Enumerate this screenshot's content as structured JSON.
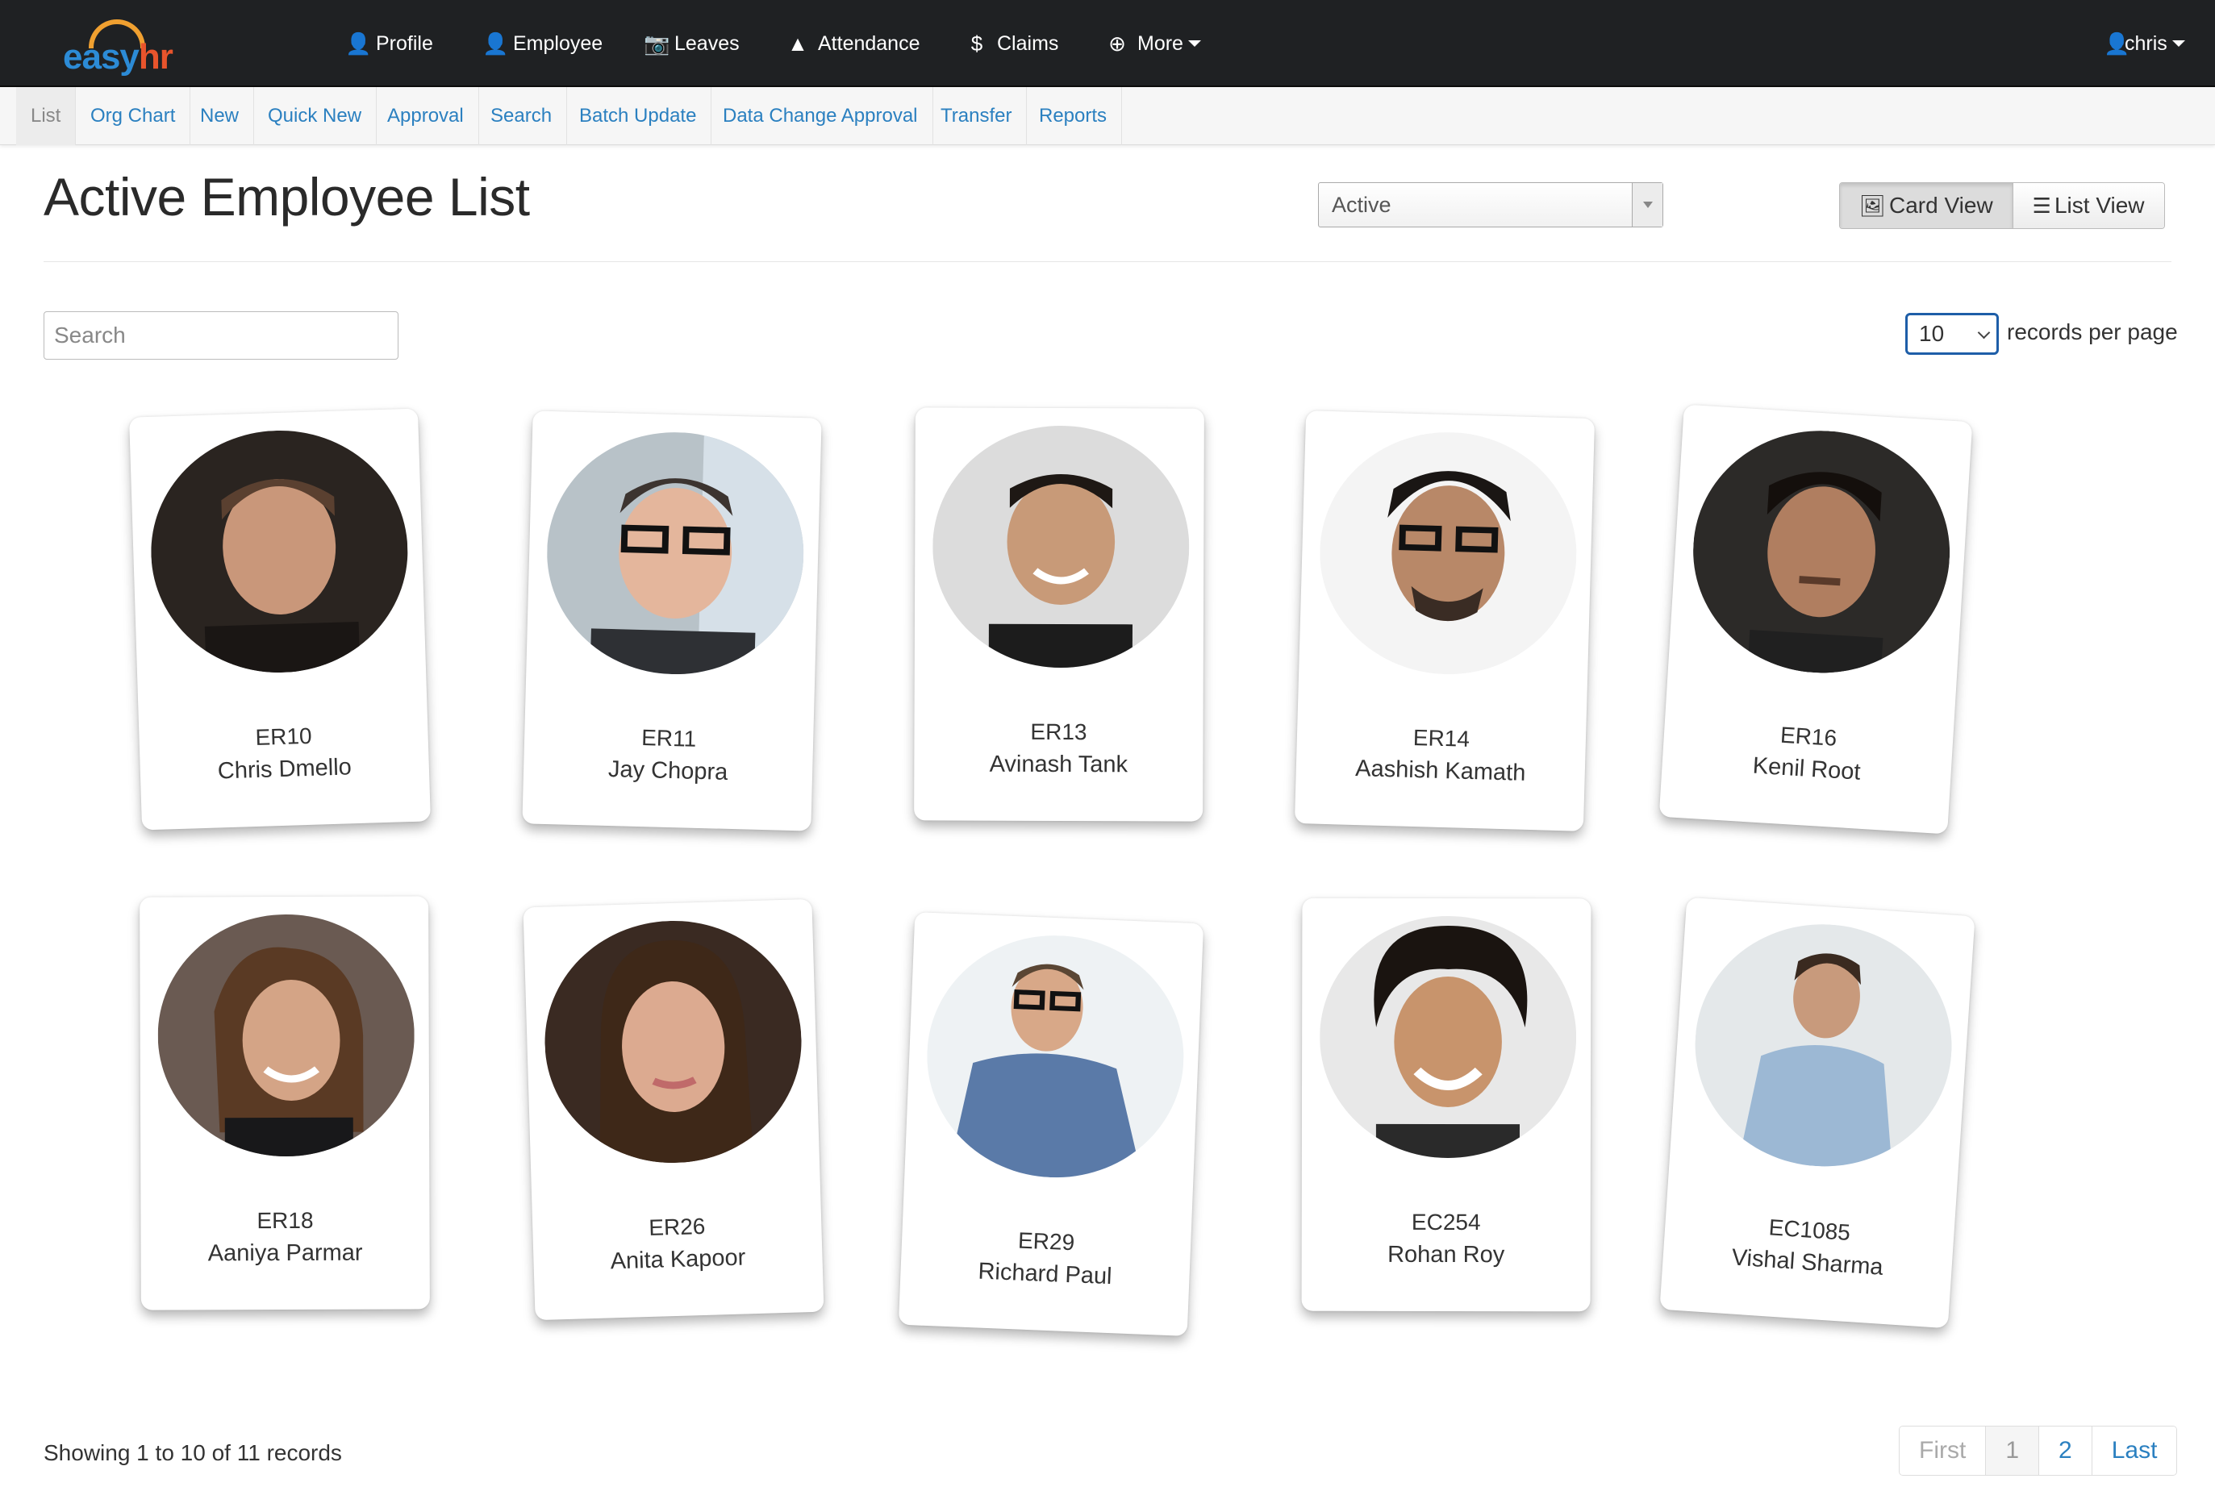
{
  "app": {
    "logo_easy": "easy",
    "logo_hr": "hr"
  },
  "nav": {
    "profile": "Profile",
    "employee": "Employee",
    "leaves": "Leaves",
    "attendance": "Attendance",
    "claims": "Claims",
    "more": "More",
    "user": "chris"
  },
  "subnav": [
    "List",
    "Org Chart",
    "New",
    "Quick New",
    "Approval",
    "Search",
    "Batch Update",
    "Data Change Approval",
    "Transfer",
    "Reports"
  ],
  "header": {
    "title": "Active Employee List",
    "status_value": "Active",
    "card_view": "Card View",
    "list_view": "List View"
  },
  "search": {
    "placeholder": "Search"
  },
  "records_per_page": {
    "value": "10",
    "label": "records per page"
  },
  "employees": [
    {
      "code": "ER10",
      "name": "Chris Dmello"
    },
    {
      "code": "ER11",
      "name": "Jay Chopra"
    },
    {
      "code": "ER13",
      "name": "Avinash Tank"
    },
    {
      "code": "ER14",
      "name": "Aashish Kamath"
    },
    {
      "code": "ER16",
      "name": "Kenil Root"
    },
    {
      "code": "ER18",
      "name": "Aaniya Parmar"
    },
    {
      "code": "ER26",
      "name": "Anita Kapoor"
    },
    {
      "code": "ER29",
      "name": "Richard Paul"
    },
    {
      "code": "EC254",
      "name": "Rohan Roy"
    },
    {
      "code": "EC1085",
      "name": "Vishal Sharma"
    }
  ],
  "footer": {
    "info": "Showing 1 to 10 of 11 records",
    "pager": {
      "first": "First",
      "p1": "1",
      "p2": "2",
      "last": "Last"
    }
  },
  "colors": {
    "navbar": "#1f2123",
    "link": "#2b80c0",
    "accent_select": "#1e5ea8"
  }
}
